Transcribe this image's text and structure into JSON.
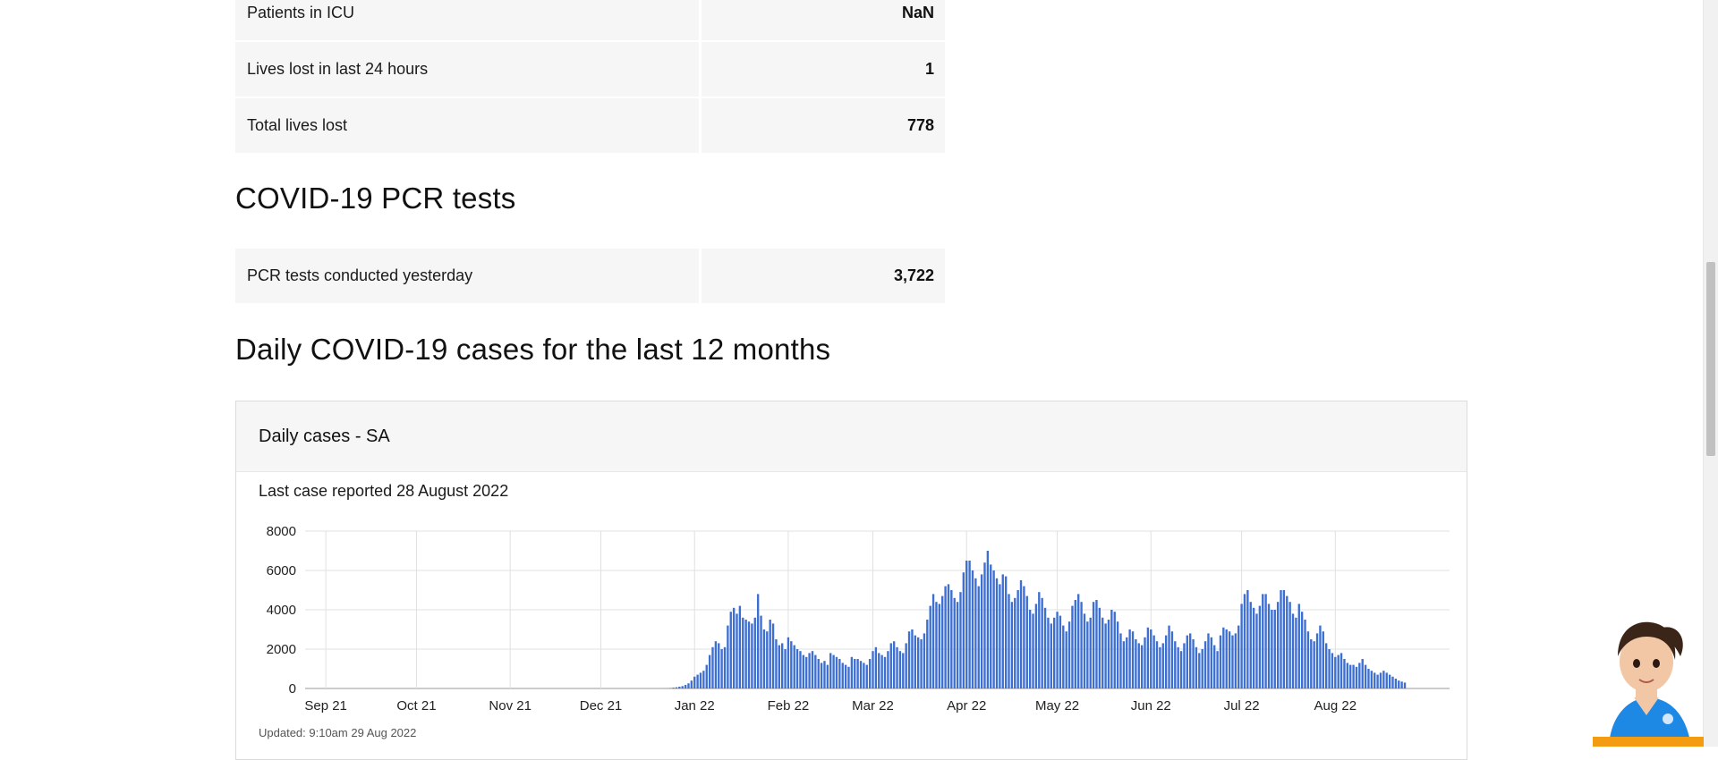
{
  "stats_top": [
    {
      "label": "Patients in ICU",
      "value": "NaN"
    },
    {
      "label": "Lives lost in last 24 hours",
      "value": "1"
    },
    {
      "label": "Total lives lost",
      "value": "778"
    }
  ],
  "pcr": {
    "heading": "COVID-19 PCR tests",
    "rows": [
      {
        "label": "PCR tests conducted yesterday",
        "value": "3,722"
      }
    ]
  },
  "daily": {
    "heading": "Daily COVID-19 cases for the last 12 months",
    "card_title": "Daily cases - SA",
    "last_case": "Last case reported 28 August 2022",
    "updated": "Updated: 9:10am 29 Aug 2022"
  },
  "colors": {
    "bar": "#3c6fd1",
    "grid": "#e0e0e0"
  },
  "chart_data": {
    "type": "bar",
    "title": "Daily cases - SA",
    "x_tick_labels": [
      "Sep 21",
      "Oct 21",
      "Nov 21",
      "Dec 21",
      "Jan 22",
      "Feb 22",
      "Mar 22",
      "Apr 22",
      "May 22",
      "Jun 22",
      "Jul 22",
      "Aug 22"
    ],
    "y_ticks": [
      0,
      2000,
      4000,
      6000,
      8000
    ],
    "ylim": [
      0,
      8000
    ],
    "grid": true,
    "x_start": "2021-08-29",
    "x_end": "2022-08-28",
    "series": [
      {
        "values": [
          0,
          0,
          0,
          0,
          0,
          0,
          0,
          0,
          0,
          0,
          0,
          0,
          0,
          0,
          0,
          0,
          0,
          0,
          0,
          0,
          0,
          0,
          0,
          0,
          0,
          0,
          0,
          0,
          0,
          0,
          0,
          0,
          0,
          0,
          0,
          0,
          0,
          0,
          0,
          0,
          0,
          0,
          0,
          0,
          0,
          0,
          0,
          0,
          0,
          0,
          0,
          0,
          0,
          0,
          0,
          0,
          0,
          0,
          0,
          0,
          0,
          0,
          0,
          0,
          0,
          0,
          0,
          0,
          0,
          0,
          0,
          0,
          0,
          0,
          0,
          0,
          0,
          0,
          0,
          0,
          0,
          0,
          0,
          0,
          0,
          0,
          0,
          0,
          0,
          0,
          0,
          0,
          0,
          0,
          0,
          0,
          0,
          0,
          0,
          0,
          0,
          0,
          0,
          0,
          0,
          0,
          0,
          0,
          0,
          0,
          0,
          0,
          0,
          0,
          0,
          5,
          10,
          20,
          40,
          60,
          90,
          120,
          180,
          260,
          400,
          600,
          700,
          800,
          900,
          1200,
          1700,
          2100,
          2400,
          2300,
          2000,
          2100,
          3200,
          3900,
          4100,
          3800,
          4200,
          3600,
          3500,
          3400,
          3300,
          3600,
          4800,
          3700,
          3000,
          2900,
          3500,
          3300,
          2500,
          2200,
          2300,
          2000,
          2600,
          2400,
          2200,
          2000,
          1900,
          1700,
          1600,
          1800,
          1900,
          1700,
          1500,
          1300,
          1400,
          1200,
          1800,
          1700,
          1600,
          1500,
          1300,
          1200,
          1100,
          1600,
          1500,
          1500,
          1400,
          1300,
          1200,
          1500,
          1900,
          2100,
          1800,
          1700,
          1600,
          1900,
          2300,
          2400,
          2100,
          1900,
          1800,
          2300,
          2900,
          3000,
          2700,
          2600,
          2500,
          2800,
          3500,
          4200,
          4800,
          4400,
          4300,
          4700,
          5200,
          5300,
          5000,
          4600,
          4400,
          4900,
          5900,
          6500,
          6500,
          6000,
          5600,
          5200,
          5800,
          6400,
          7000,
          6300,
          6000,
          5600,
          5300,
          5800,
          5700,
          4800,
          4400,
          4600,
          5000,
          5500,
          5200,
          4700,
          4000,
          3800,
          4300,
          4900,
          4600,
          4100,
          3600,
          3300,
          3600,
          3900,
          3700,
          3200,
          2900,
          3400,
          4200,
          4500,
          4800,
          4400,
          3800,
          3400,
          3600,
          4400,
          4500,
          4100,
          3600,
          3300,
          3500,
          4000,
          3900,
          3400,
          2800,
          2400,
          2600,
          3000,
          2900,
          2500,
          2300,
          2200,
          2600,
          3100,
          3000,
          2700,
          2400,
          2100,
          2300,
          2700,
          3200,
          2900,
          2400,
          2100,
          1900,
          2300,
          2700,
          2800,
          2500,
          2100,
          1800,
          2000,
          2400,
          2800,
          2600,
          2200,
          1900,
          2700,
          3100,
          3000,
          2900,
          2700,
          2800,
          3200,
          4300,
          4800,
          5000,
          4400,
          4100,
          3800,
          4200,
          4800,
          4800,
          4300,
          4000,
          4000,
          4400,
          5000,
          5000,
          4700,
          4400,
          3800,
          3600,
          4300,
          3900,
          3500,
          2900,
          2500,
          2400,
          2800,
          3200,
          2900,
          2300,
          2000,
          1800,
          1600,
          1700,
          1800,
          1500,
          1300,
          1200,
          1200,
          1100,
          1300,
          1500,
          1200,
          1000,
          900,
          800,
          700,
          800,
          900,
          800,
          700,
          600,
          500,
          400,
          350,
          300
        ]
      }
    ]
  }
}
